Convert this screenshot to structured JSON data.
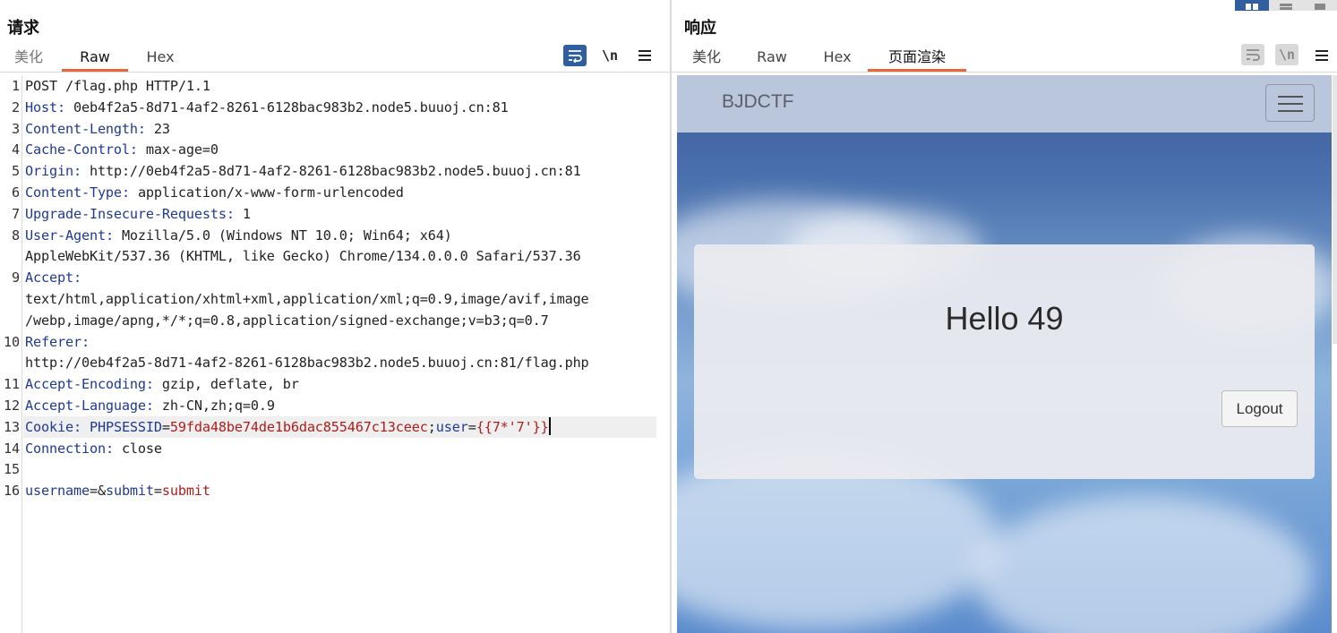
{
  "request": {
    "title": "请求",
    "tabs": [
      "美化",
      "Raw",
      "Hex"
    ],
    "active_tab": "Raw",
    "toolbar": {
      "wrap_icon": "wrap-lines-icon",
      "newline_label": "\\n",
      "menu_icon": "hamburger-menu-icon"
    },
    "lines": [
      {
        "n": "1",
        "plain": "POST /flag.php HTTP/1.1"
      },
      {
        "n": "2",
        "key": "Host",
        "sep": ": ",
        "val": "0eb4f2a5-8d71-4af2-8261-6128bac983b2.node5.buuoj.cn:81"
      },
      {
        "n": "3",
        "key": "Content-Length",
        "sep": ": ",
        "val": "23"
      },
      {
        "n": "4",
        "key": "Cache-Control",
        "sep": ": ",
        "val": "max-age=0"
      },
      {
        "n": "5",
        "key": "Origin",
        "sep": ": ",
        "val": "http://0eb4f2a5-8d71-4af2-8261-6128bac983b2.node5.buuoj.cn:81"
      },
      {
        "n": "6",
        "key": "Content-Type",
        "sep": ": ",
        "val": "application/x-www-form-urlencoded"
      },
      {
        "n": "7",
        "key": "Upgrade-Insecure-Requests",
        "sep": ": ",
        "val": "1"
      },
      {
        "n": "8",
        "key": "User-Agent",
        "sep": ": ",
        "val": "Mozilla/5.0 (Windows NT 10.0; Win64; x64)"
      },
      {
        "n": "",
        "plain": "AppleWebKit/537.36 (KHTML, like Gecko) Chrome/134.0.0.0 Safari/537.36"
      },
      {
        "n": "9",
        "key": "Accept",
        "sep": ":",
        "val": ""
      },
      {
        "n": "",
        "plain": "text/html,application/xhtml+xml,application/xml;q=0.9,image/avif,image"
      },
      {
        "n": "",
        "plain": "/webp,image/apng,*/*;q=0.8,application/signed-exchange;v=b3;q=0.7"
      },
      {
        "n": "10",
        "key": "Referer",
        "sep": ":",
        "val": ""
      },
      {
        "n": "",
        "plain": "http://0eb4f2a5-8d71-4af2-8261-6128bac983b2.node5.buuoj.cn:81/flag.php"
      },
      {
        "n": "11",
        "key": "Accept-Encoding",
        "sep": ": ",
        "val": "gzip, deflate, br"
      },
      {
        "n": "12",
        "key": "Accept-Language",
        "sep": ": ",
        "val": "zh-CN,zh;q=0.9"
      },
      {
        "n": "13",
        "cookie": {
          "key": "Cookie",
          "sep": ": ",
          "name1": "PHPSESSID",
          "eq1": "=",
          "value1": "59fda48be74de1b6dac855467c13ceec",
          "semi": ";",
          "name2": "user",
          "eq2": "=",
          "value2": "{{7*'7'}}"
        }
      },
      {
        "n": "14",
        "key": "Connection",
        "sep": ": ",
        "val": "close"
      },
      {
        "n": "15",
        "plain": ""
      },
      {
        "n": "16",
        "body": {
          "p1": "username",
          "eq1": "=",
          "amp": "&",
          "p2": "submit",
          "eq2": "=",
          "v2": "submit"
        }
      }
    ]
  },
  "response": {
    "title": "响应",
    "tabs": [
      "美化",
      "Raw",
      "Hex",
      "页面渲染"
    ],
    "active_tab": "页面渲染",
    "toolbar": {
      "wrap_icon": "wrap-lines-icon",
      "newline_label": "\\n",
      "menu_icon": "hamburger-menu-icon"
    },
    "layout_icons": [
      "split-columns-icon",
      "split-rows-icon",
      "single-pane-icon"
    ],
    "render": {
      "brand": "BJDCTF",
      "toggler_icon": "navbar-toggler-icon",
      "greeting": "Hello 49",
      "logout_label": "Logout"
    }
  },
  "colors": {
    "accent_tab": "#e8673a",
    "active_button": "#2f5f9e",
    "header_key": "#1f3a93",
    "value_red": "#b01c1c"
  }
}
